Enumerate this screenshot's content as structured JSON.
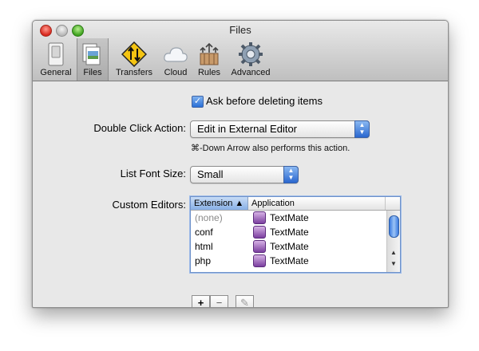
{
  "window": {
    "title": "Files"
  },
  "toolbar": {
    "items": [
      {
        "label": "General",
        "icon": "switch-icon"
      },
      {
        "label": "Files",
        "icon": "files-icon"
      },
      {
        "label": "Transfers",
        "icon": "transfers-icon"
      },
      {
        "label": "Cloud",
        "icon": "cloud-icon"
      },
      {
        "label": "Rules",
        "icon": "rules-icon"
      },
      {
        "label": "Advanced",
        "icon": "gear-icon"
      }
    ],
    "selected": "Files"
  },
  "ask_delete": {
    "label": "Ask before deleting items",
    "checked": true
  },
  "double_click": {
    "label": "Double Click Action:",
    "value": "Edit in External Editor",
    "hint": "⌘-Down Arrow also performs this action."
  },
  "font_size": {
    "label": "List Font Size:",
    "value": "Small"
  },
  "editors": {
    "label": "Custom Editors:",
    "columns": [
      "Extension ▲",
      "Application"
    ],
    "rows": [
      {
        "ext": "(none)",
        "app": "TextMate"
      },
      {
        "ext": "conf",
        "app": "TextMate"
      },
      {
        "ext": "html",
        "app": "TextMate"
      },
      {
        "ext": "php",
        "app": "TextMate"
      }
    ]
  },
  "buttons": {
    "add": "+",
    "remove": "−",
    "edit": "✎"
  },
  "colors": {
    "accent": "#2a6fd6",
    "toolbar_bg": "#cfcfcf",
    "window_bg": "#e8e8e8"
  }
}
